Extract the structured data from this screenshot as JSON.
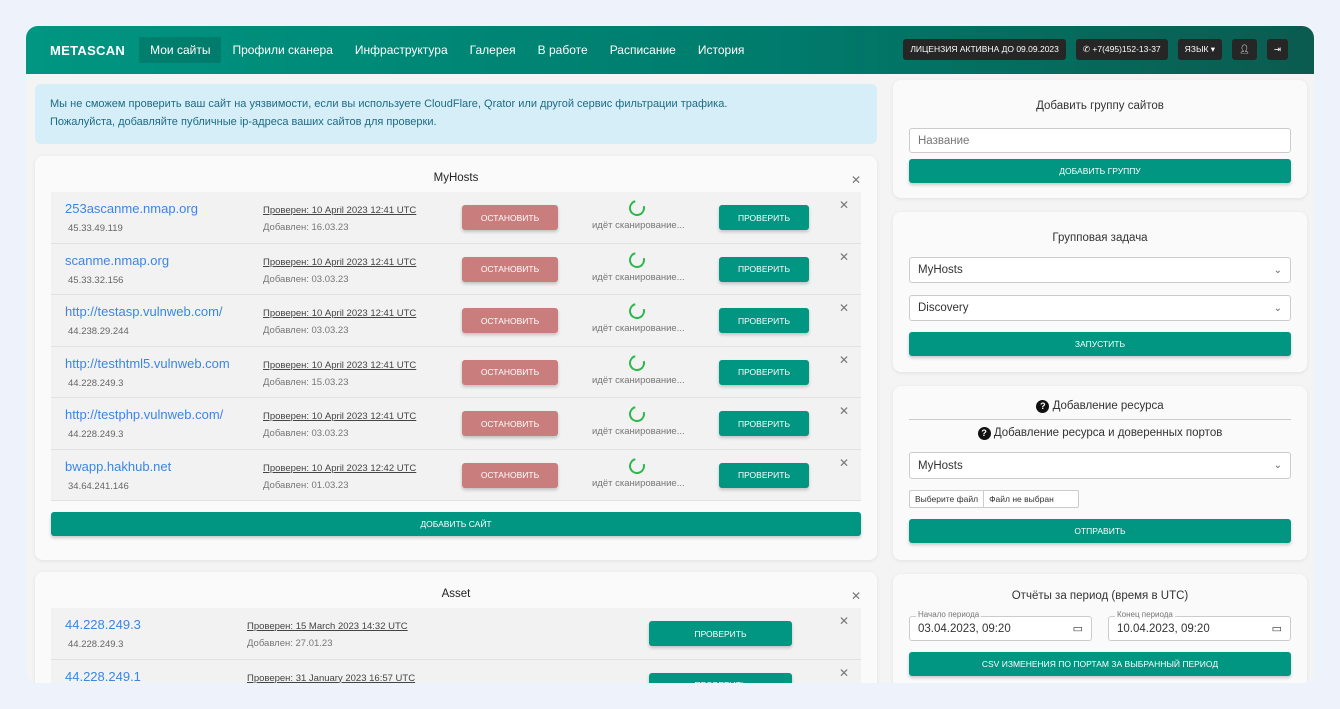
{
  "nav": {
    "brand": "METASCAN",
    "items": [
      "Мои сайты",
      "Профили сканера",
      "Инфраструктура",
      "Галерея",
      "В работе",
      "Расписание",
      "История"
    ],
    "license": "ЛИЦЕНЗИЯ АКТИВНА ДО 09.09.2023",
    "phone": "+7(495)152-13-37",
    "lang": "ЯЗЫК"
  },
  "alert": {
    "line1": "Мы не сможем проверить ваш сайт на уязвимости, если вы используете CloudFlare, Qrator или другой сервис фильтрации трафика.",
    "line2": "Пожалуйста, добавляйте публичные ip-адреса ваших сайтов для проверки."
  },
  "groups": [
    {
      "title": "MyHosts",
      "stop": "ОСТАНОВИТЬ",
      "check": "ПРОВЕРИТЬ",
      "scanning": "идёт сканирование...",
      "add_site": "ДОБАВИТЬ САЙТ",
      "rows": [
        {
          "host": "253ascanme.nmap.org",
          "ip": "45.33.49.119",
          "checked": "Проверен: 10 April 2023 12:41 UTC",
          "added": "Добавлен: 16.03.23"
        },
        {
          "host": "scanme.nmap.org",
          "ip": "45.33.32.156",
          "checked": "Проверен: 10 April 2023 12:41 UTC",
          "added": "Добавлен: 03.03.23"
        },
        {
          "host": "http://testasp.vulnweb.com/",
          "ip": "44.238.29.244",
          "checked": "Проверен: 10 April 2023 12:41 UTC",
          "added": "Добавлен: 03.03.23"
        },
        {
          "host": "http://testhtml5.vulnweb.com",
          "ip": "44.228.249.3",
          "checked": "Проверен: 10 April 2023 12:41 UTC",
          "added": "Добавлен: 15.03.23"
        },
        {
          "host": "http://testphp.vulnweb.com/",
          "ip": "44.228.249.3",
          "checked": "Проверен: 10 April 2023 12:41 UTC",
          "added": "Добавлен: 03.03.23"
        },
        {
          "host": "bwapp.hakhub.net",
          "ip": "34.64.241.146",
          "checked": "Проверен: 10 April 2023 12:42 UTC",
          "added": "Добавлен: 01.03.23"
        }
      ]
    },
    {
      "title": "Asset",
      "check": "ПРОВЕРИТЬ",
      "rows": [
        {
          "host": "44.228.249.3",
          "ip": "44.228.249.3",
          "checked": "Проверен: 15 March 2023 14:32 UTC",
          "added": "Добавлен: 27.01.23"
        },
        {
          "host": "44.228.249.1",
          "ip": "",
          "checked": "Проверен: 31 January 2023 16:57 UTC",
          "added": ""
        }
      ]
    }
  ],
  "add_group": {
    "title": "Добавить группу сайтов",
    "placeholder": "Название",
    "button": "ДОБАВИТЬ ГРУППУ"
  },
  "group_task": {
    "title": "Групповая задача",
    "group": "MyHosts",
    "task": "Discovery",
    "button": "ЗАПУСТИТЬ"
  },
  "add_resource": {
    "title": "Добавление ресурса",
    "subtitle": "Добавление ресурса и доверенных портов",
    "group": "MyHosts",
    "file_button": "Выберите файл",
    "file_status": "Файл не выбран",
    "button": "ОТПРАВИТЬ"
  },
  "reports": {
    "title": "Отчёты за период (время в UTC)",
    "start_label": "Начало периода",
    "start": "03.04.2023, 09:20",
    "end_label": "Конец периода",
    "end": "10.04.2023, 09:20",
    "button": "CSV ИЗМЕНЕНИЯ ПО ПОРТАМ ЗА ВЫБРАННЫЙ ПЕРИОД"
  }
}
